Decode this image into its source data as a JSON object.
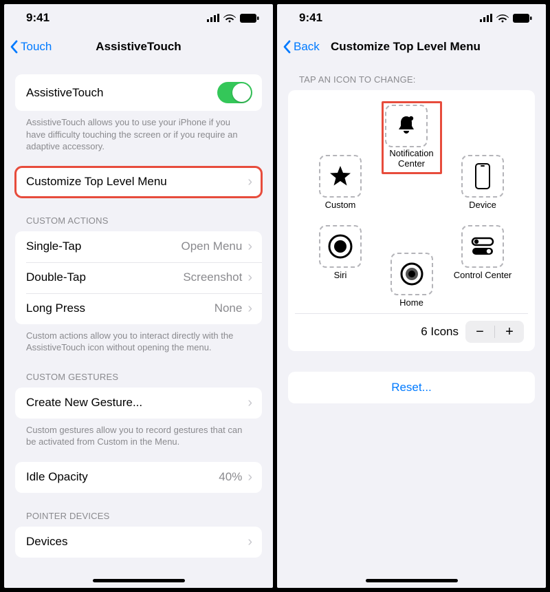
{
  "status": {
    "time": "9:41"
  },
  "left": {
    "back": "Touch",
    "title": "AssistiveTouch",
    "toggle_label": "AssistiveTouch",
    "toggle_footer": "AssistiveTouch allows you to use your iPhone if you have difficulty touching the screen or if you require an adaptive accessory.",
    "customize_label": "Customize Top Level Menu",
    "actions_header": "CUSTOM ACTIONS",
    "actions": [
      {
        "label": "Single-Tap",
        "value": "Open Menu"
      },
      {
        "label": "Double-Tap",
        "value": "Screenshot"
      },
      {
        "label": "Long Press",
        "value": "None"
      }
    ],
    "actions_footer": "Custom actions allow you to interact directly with the AssistiveTouch icon without opening the menu.",
    "gestures_header": "CUSTOM GESTURES",
    "create_gesture_label": "Create New Gesture...",
    "gestures_footer": "Custom gestures allow you to record gestures that can be activated from Custom in the Menu.",
    "opacity_label": "Idle Opacity",
    "opacity_value": "40%",
    "pointer_header": "POINTER DEVICES",
    "devices_label": "Devices"
  },
  "right": {
    "back": "Back",
    "title": "Customize Top Level Menu",
    "tap_header": "TAP AN ICON TO CHANGE:",
    "icons": {
      "notification": "Notification Center",
      "custom": "Custom",
      "device": "Device",
      "siri": "Siri",
      "control": "Control Center",
      "home": "Home"
    },
    "count_label": "6 Icons",
    "reset": "Reset..."
  }
}
